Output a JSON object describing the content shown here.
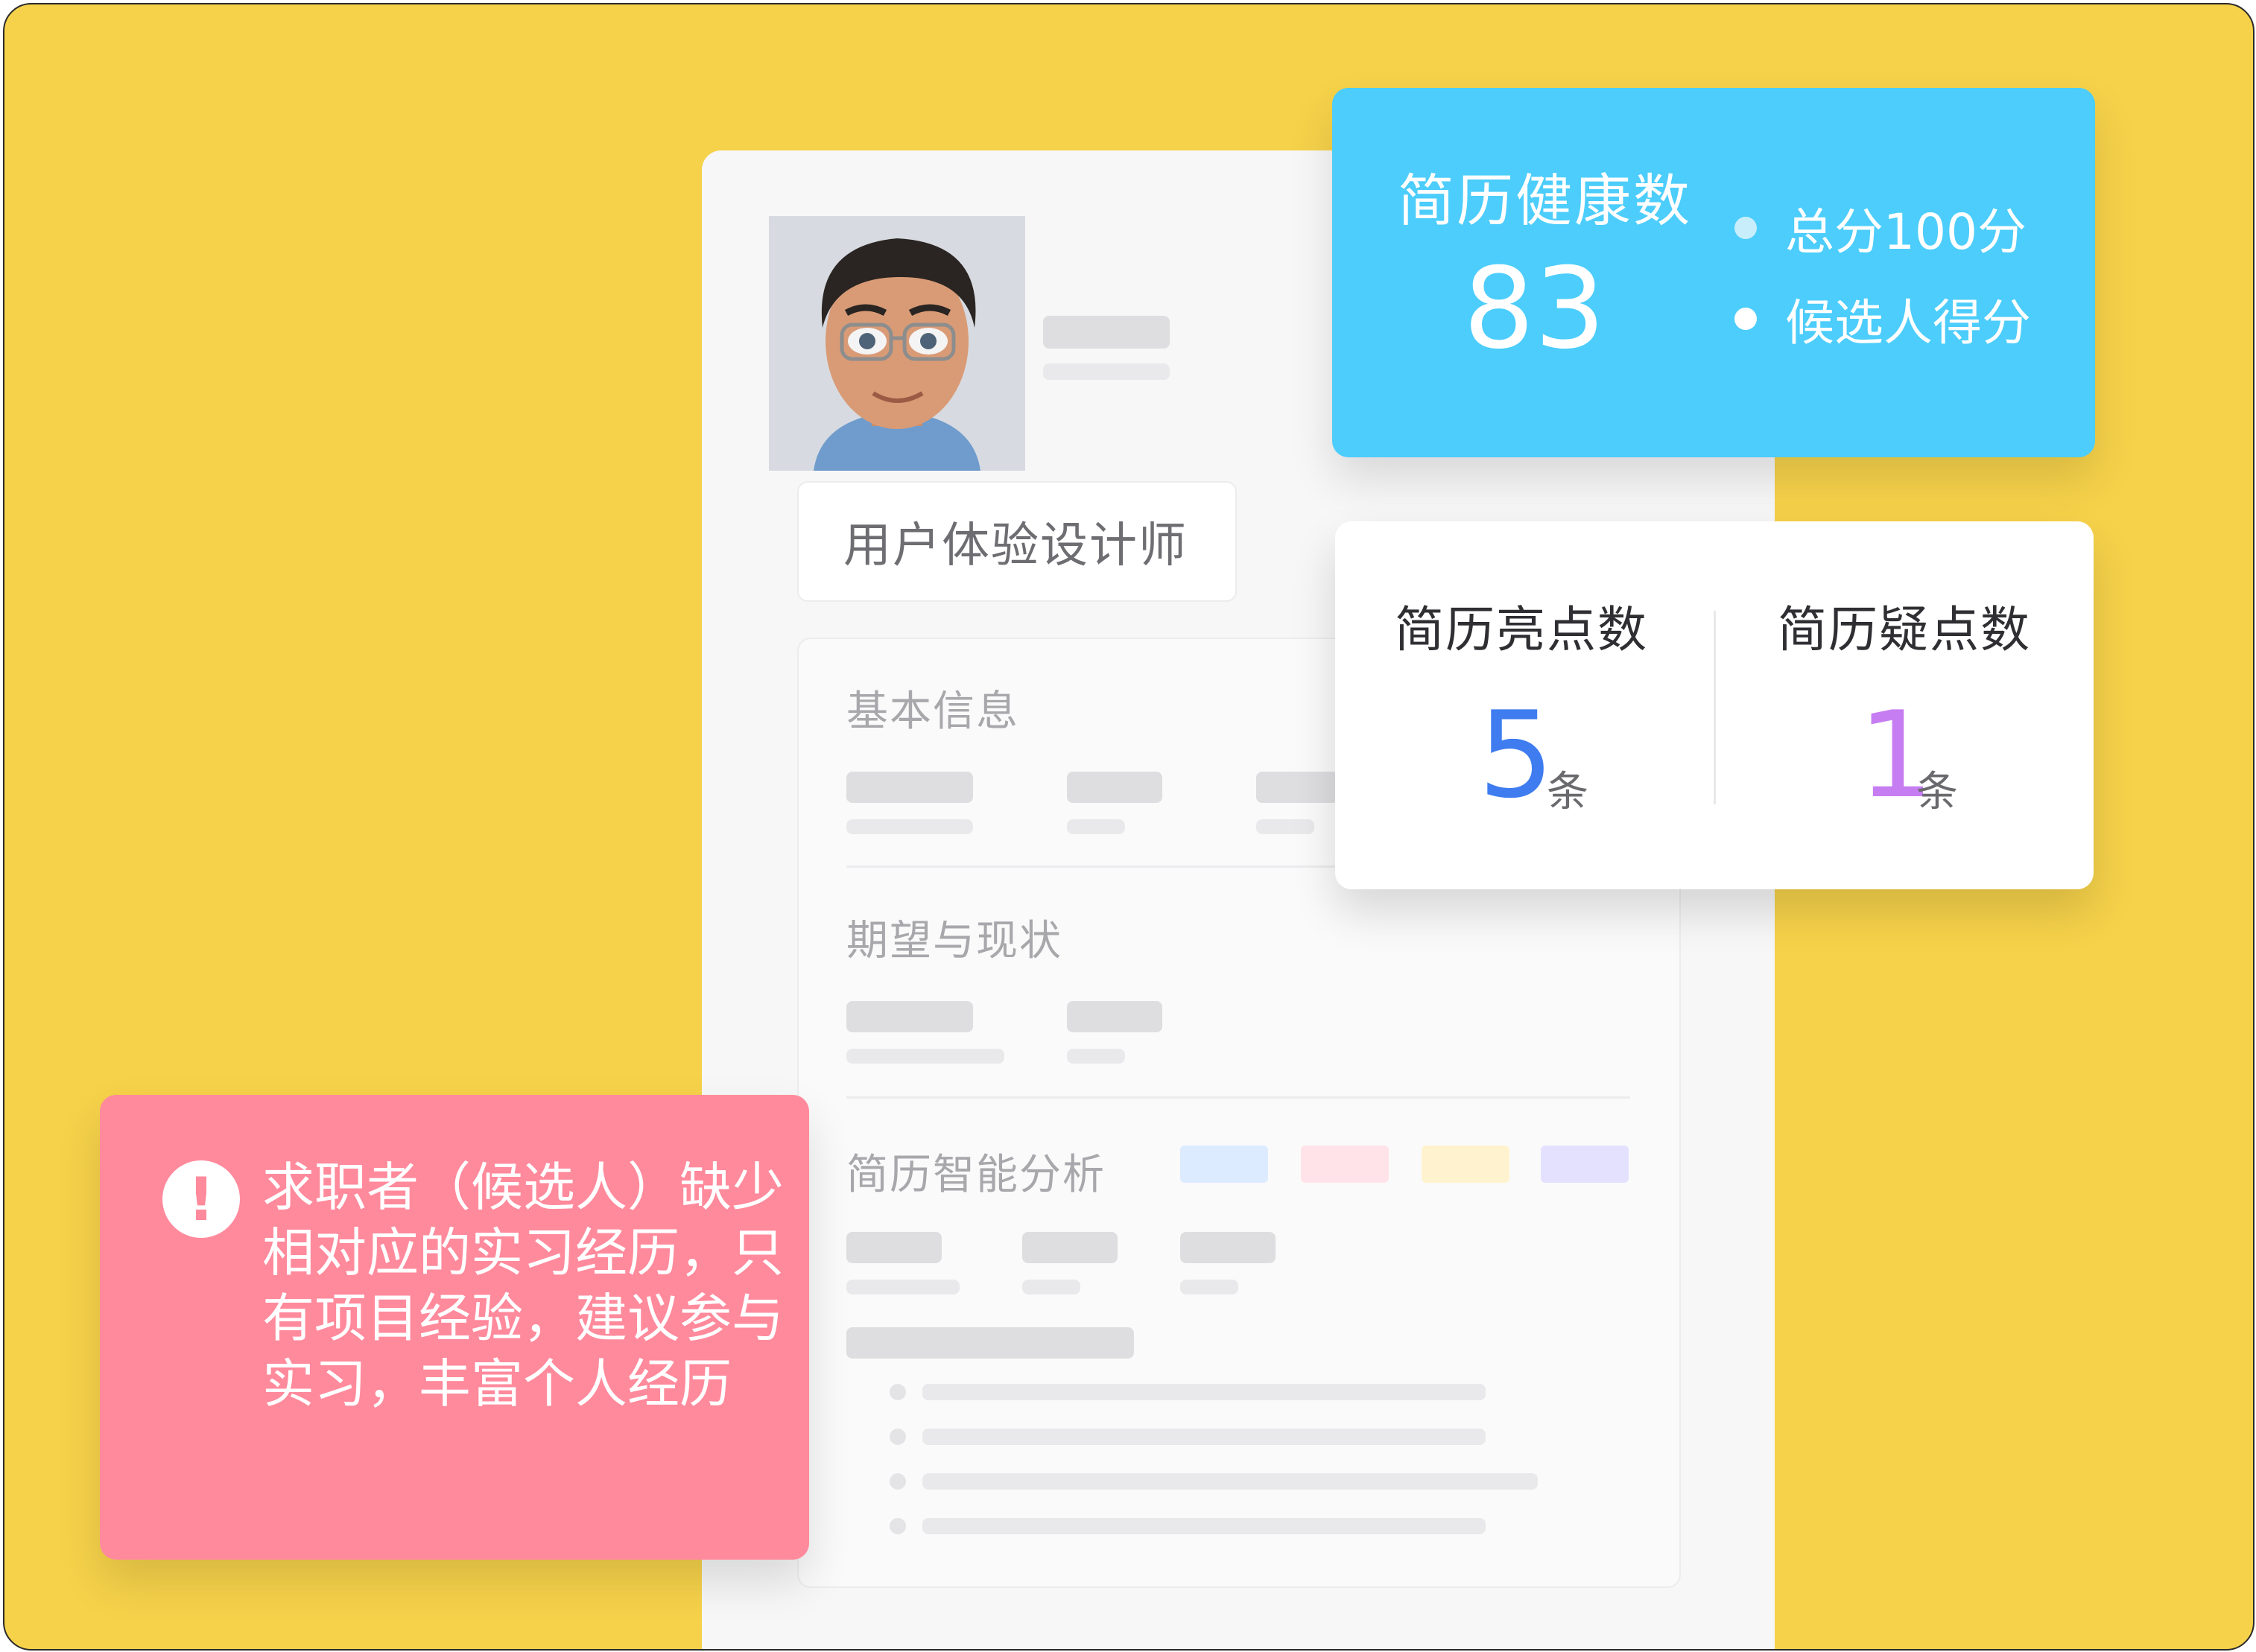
{
  "job_title": "用户体验设计师",
  "sections": {
    "basic_info": "基本信息",
    "expectation": "期望与现状",
    "analysis": "简历智能分析"
  },
  "health_card": {
    "title": "简历健康数",
    "score": "83",
    "legend": [
      {
        "label": "总分100分",
        "color": "#C8EEFC"
      },
      {
        "label": "候选人得分",
        "color": "#FFFFFF"
      }
    ]
  },
  "points_card": {
    "highlights_title": "简历亮点数",
    "highlights_value": "5",
    "highlights_unit": "条",
    "highlights_color": "#3F7CF0",
    "doubts_title": "简历疑点数",
    "doubts_value": "1",
    "doubts_unit": "条",
    "doubts_color": "#C77DF2"
  },
  "tag_colors": [
    "#DCEBFF",
    "#FFE3E8",
    "#FFF3CF",
    "#E4E1FF"
  ],
  "alert": {
    "icon": "exclamation-icon",
    "text": "求职者（候选人）缺少相对应的实习经历，只有项目经验，建议参与实习，丰富个人经历"
  }
}
